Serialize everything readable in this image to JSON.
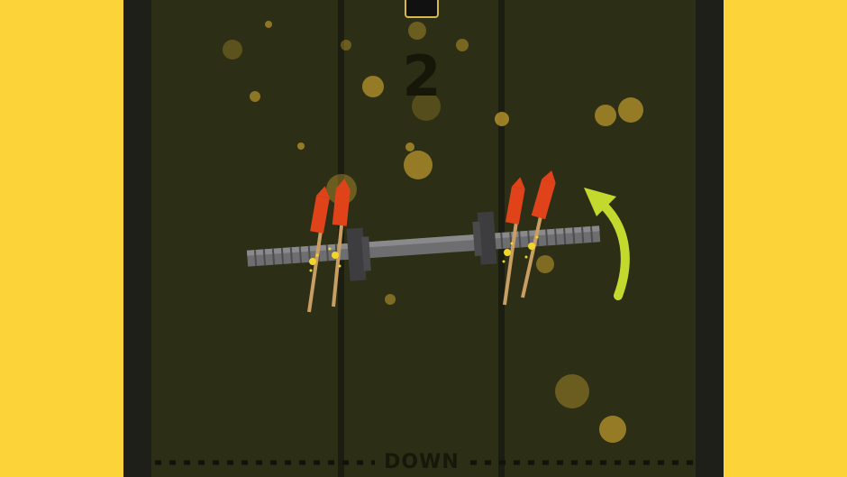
{
  "game": {
    "score": "2",
    "top_button_label": "",
    "bottom_label": "DOWN",
    "colors": {
      "background": "#fdd33a",
      "playfield": "#2c2e16",
      "arrow": "#c3d92e",
      "rocket": "#e0421a",
      "particle": "#c8a032"
    },
    "icons": {
      "arrow": "rotate-arrow-icon",
      "rocket": "firework-rocket-icon"
    }
  }
}
